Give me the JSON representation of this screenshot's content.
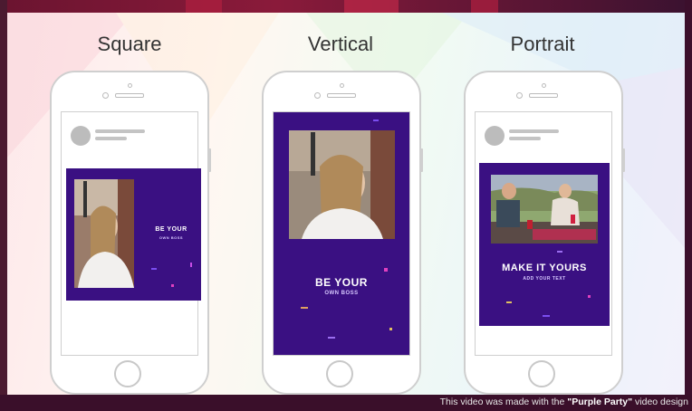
{
  "layouts": [
    {
      "heading": "Square",
      "headline": "BE YOUR",
      "subline": "OWN BOSS"
    },
    {
      "heading": "Vertical",
      "headline": "BE YOUR",
      "subline": "OWN BOSS"
    },
    {
      "heading": "Portrait",
      "headline": "MAKE IT YOURS",
      "subline": "ADD YOUR TEXT"
    }
  ],
  "caption": {
    "prefix": "This video was made with the ",
    "design_name": "\"Purple Party\"",
    "suffix": " video design"
  },
  "colors": {
    "post_purple": "#3a1082",
    "page_bg": "#4a1430"
  },
  "icons": {
    "home": "home-button-icon",
    "avatar": "avatar-placeholder-icon"
  }
}
